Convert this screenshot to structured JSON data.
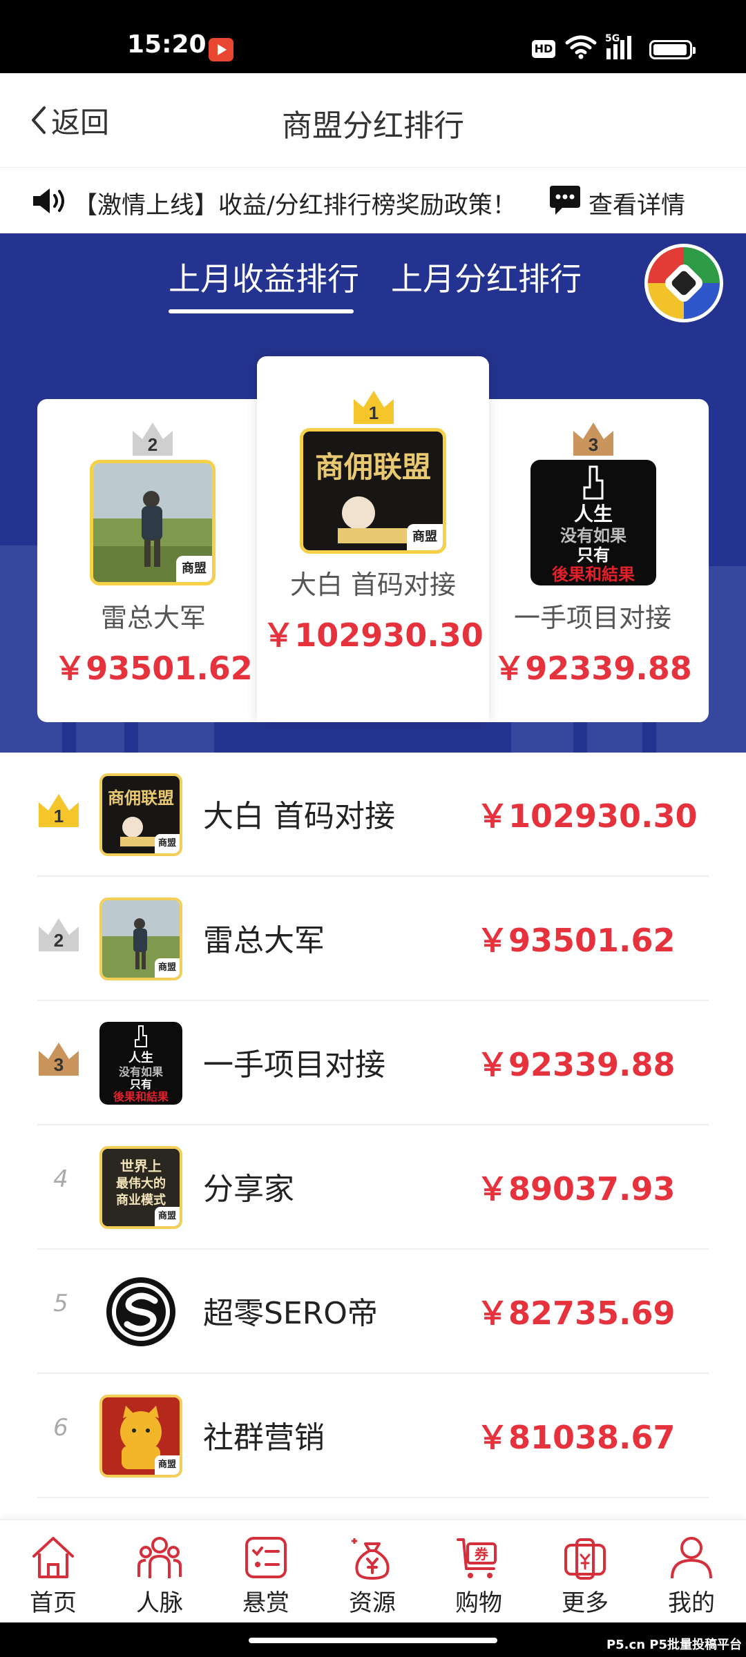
{
  "status_bar": {
    "time": "15:20",
    "hd": "HD",
    "network": "5G"
  },
  "header": {
    "back_label": "返回",
    "title": "商盟分红排行"
  },
  "notice": {
    "text": "【激情上线】收益/分红排行榜奖励政策！",
    "detail_label": "查看详情"
  },
  "tabs": [
    {
      "label": "上月收益排行",
      "active": true
    },
    {
      "label": "上月分红排行",
      "active": false
    }
  ],
  "podium": [
    {
      "rank": "2",
      "name": "雷总大军",
      "amount": "￥93501.62",
      "tag": "商盟"
    },
    {
      "rank": "1",
      "name": "大白 首码对接",
      "amount": "￥102930.30",
      "tag": "商盟"
    },
    {
      "rank": "3",
      "name": "一手项目对接",
      "amount": "￥92339.88",
      "tag": ""
    }
  ],
  "avatar_text": {
    "rank1": "商佣联盟",
    "rank3": [
      "人生",
      "没有如果",
      "只有",
      "後果和結果"
    ],
    "rank4": [
      "世界上",
      "最伟大的",
      "商业模式"
    ]
  },
  "ranking": [
    {
      "rank": "1",
      "name": "大白 首码对接",
      "amount": "￥102930.30",
      "tag": "商盟"
    },
    {
      "rank": "2",
      "name": "雷总大军",
      "amount": "￥93501.62",
      "tag": "商盟"
    },
    {
      "rank": "3",
      "name": "一手项目对接",
      "amount": "￥92339.88",
      "tag": ""
    },
    {
      "rank": "4",
      "name": "分享家",
      "amount": "￥89037.93",
      "tag": "商盟"
    },
    {
      "rank": "5",
      "name": "超零SERO帝",
      "amount": "￥82735.69",
      "tag": ""
    },
    {
      "rank": "6",
      "name": "社群营销",
      "amount": "￥81038.67",
      "tag": "商盟"
    }
  ],
  "nav": [
    {
      "label": "首页",
      "icon": "home-icon"
    },
    {
      "label": "人脉",
      "icon": "people-icon"
    },
    {
      "label": "悬赏",
      "icon": "checklist-icon"
    },
    {
      "label": "资源",
      "icon": "money-bag-icon"
    },
    {
      "label": "购物",
      "icon": "cart-icon"
    },
    {
      "label": "更多",
      "icon": "wallet-icon"
    },
    {
      "label": "我的",
      "icon": "user-icon"
    }
  ],
  "watermark": "P5.cn P5批量投稿平台",
  "colors": {
    "primary_blue": "#24338f",
    "amount_red": "#e5323d",
    "nav_red": "#d42f3a",
    "gold": "#f2cf58"
  }
}
